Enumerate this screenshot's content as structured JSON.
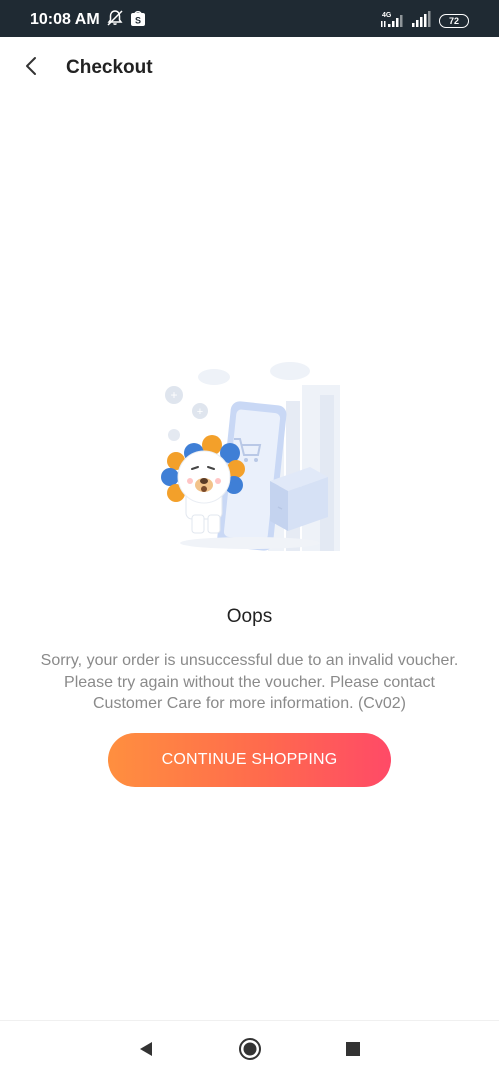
{
  "status_bar": {
    "time": "10:08 AM",
    "network_label": "4G",
    "battery_level": "72",
    "icons": [
      "notification-muted-icon",
      "shopee-notification-icon",
      "signal-4g-icon",
      "signal-icon",
      "battery-icon"
    ]
  },
  "header": {
    "title": "Checkout",
    "back_icon": "chevron-left-icon"
  },
  "illustration": {
    "name": "mascot-phone-box-illustration"
  },
  "message": {
    "title": "Oops",
    "body": "Sorry, your order is unsuccessful due to an invalid voucher. Please try again without the voucher. Please contact Customer Care for more information. (Cv02)"
  },
  "actions": {
    "continue_label": "CONTINUE SHOPPING"
  },
  "navigation": {
    "icons": [
      "back-triangle-icon",
      "home-circle-icon",
      "recents-square-icon"
    ]
  },
  "colors": {
    "status_bar_bg": "#1f2a33",
    "button_gradient_start": "#ff8f3f",
    "button_gradient_end": "#ff4a67",
    "title_text": "#222222",
    "body_text": "#8a8a8a"
  }
}
